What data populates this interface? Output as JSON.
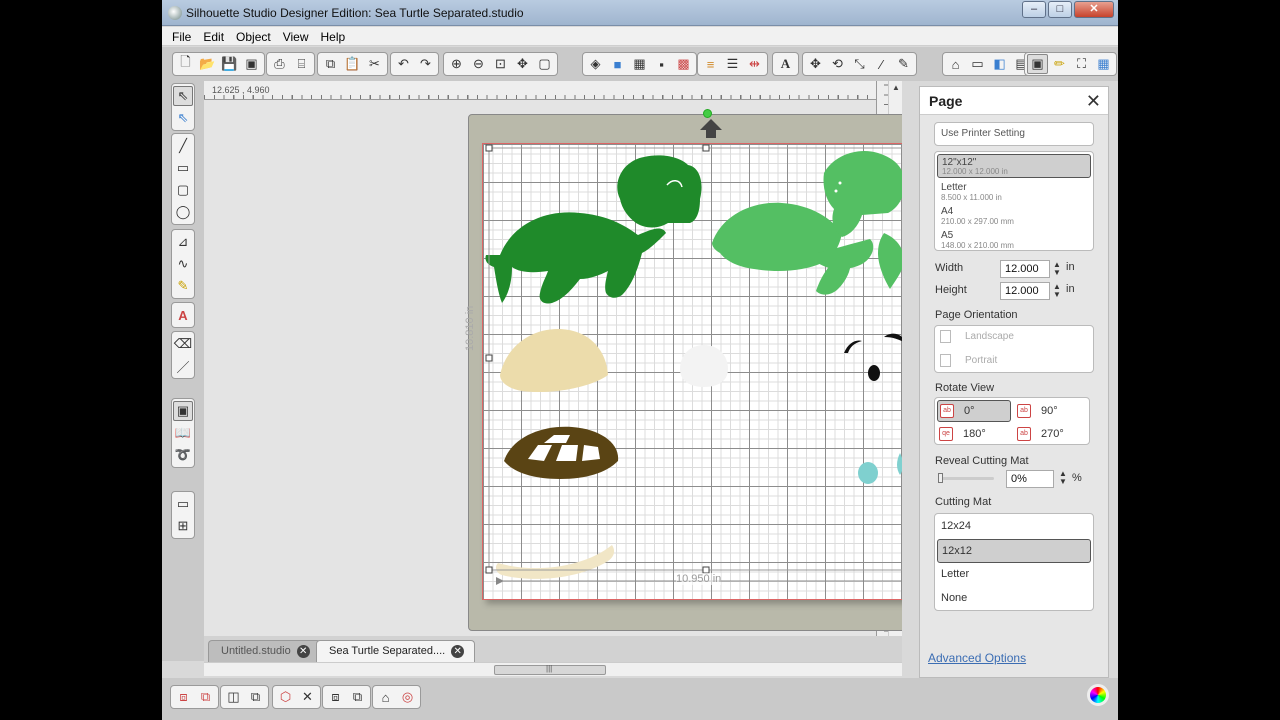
{
  "window": {
    "title": "Silhouette Studio Designer Edition: Sea Turtle Separated.studio"
  },
  "menu": [
    "File",
    "Edit",
    "Object",
    "View",
    "Help"
  ],
  "ruler": {
    "coords": "12.625 , 4.960"
  },
  "canvas": {
    "width_label": "10.950 in",
    "height_label": "10.810 in"
  },
  "tabs": [
    {
      "label": "Untitled.studio",
      "active": false
    },
    {
      "label": "Sea Turtle Separated....",
      "active": true
    }
  ],
  "panel": {
    "title": "Page",
    "use_printer": "Use Printer Setting",
    "paper_sizes": [
      {
        "name": "12\"x12\"",
        "dims": "12.000 x 12.000 in",
        "selected": true
      },
      {
        "name": "Letter",
        "dims": "8.500 x 11.000 in",
        "selected": false
      },
      {
        "name": "A4",
        "dims": "210.00 x 297.00 mm",
        "selected": false
      },
      {
        "name": "A5",
        "dims": "148.00 x 210.00 mm",
        "selected": false
      }
    ],
    "width_label": "Width",
    "width_value": "12.000",
    "width_unit": "in",
    "height_label": "Height",
    "height_value": "12.000",
    "height_unit": "in",
    "orientation_label": "Page Orientation",
    "orientation": [
      "Landscape",
      "Portrait"
    ],
    "rotate_label": "Rotate View",
    "rotations": [
      {
        "label": "0°",
        "icon": "ab",
        "selected": true
      },
      {
        "label": "90°",
        "icon": "ab",
        "selected": false
      },
      {
        "label": "180°",
        "icon": "qe",
        "selected": false
      },
      {
        "label": "270°",
        "icon": "ab",
        "selected": false
      }
    ],
    "reveal_label": "Reveal Cutting Mat",
    "reveal_value": "0%",
    "reveal_fraction": 0.0,
    "reveal_unit": "%",
    "mat_label": "Cutting Mat",
    "mats": [
      {
        "label": "12x24",
        "selected": false
      },
      {
        "label": "12x12",
        "selected": true
      },
      {
        "label": "Letter",
        "selected": false
      },
      {
        "label": "None",
        "selected": false
      }
    ],
    "advanced": "Advanced Options"
  },
  "colors": {
    "dark_green": "#1f8a2a",
    "light_green": "#54bf63",
    "tan": "#ecdcab",
    "brown": "#5a4414",
    "teal": "#7fd0cf",
    "accent_red": "#cc4444"
  }
}
